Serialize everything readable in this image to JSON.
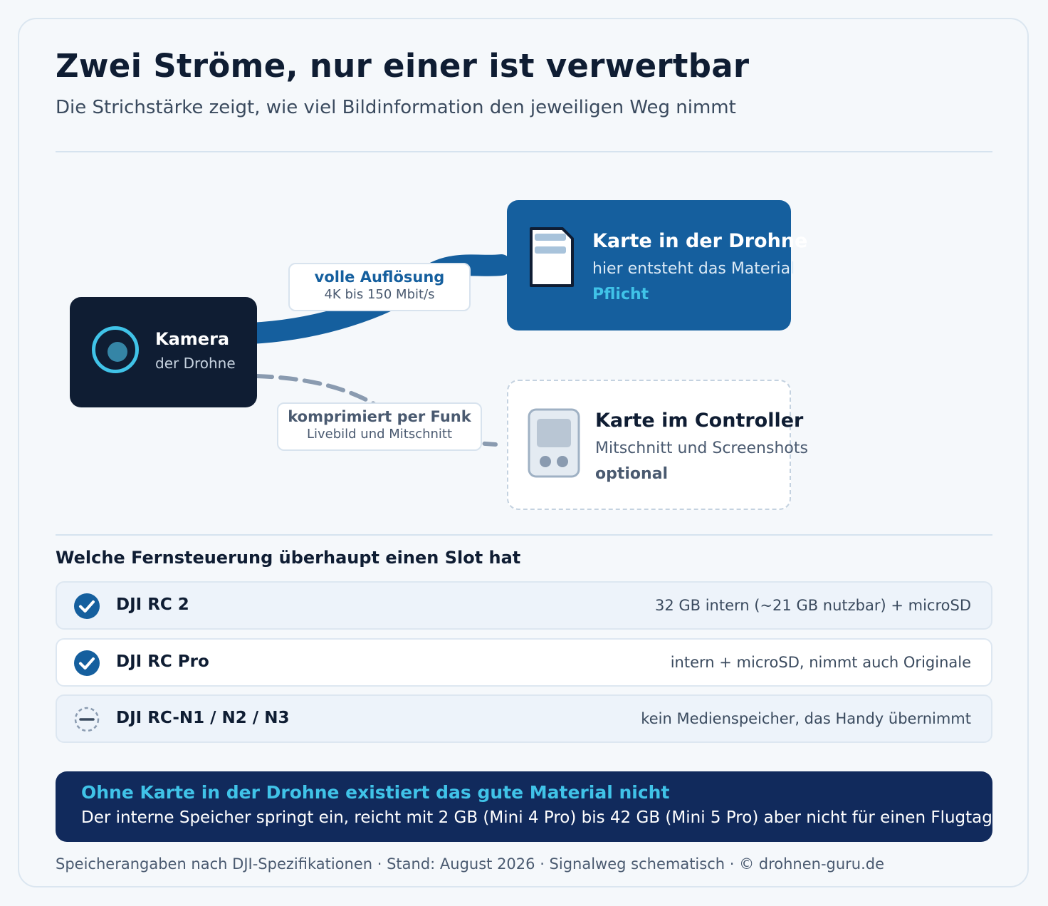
{
  "header": {
    "title": "Zwei Ströme, nur einer ist verwertbar",
    "subtitle": "Die Strichstärke zeigt, wie viel Bildinformation den jeweiligen Weg nimmt"
  },
  "diagram": {
    "camera": {
      "title": "Kamera",
      "subtitle": "der Drohne"
    },
    "drone_card": {
      "title": "Karte in der Drohne",
      "subtitle": "hier entsteht das Material",
      "tag": "Pflicht"
    },
    "controller_card": {
      "title": "Karte im Controller",
      "subtitle": "Mitschnitt und Screenshots",
      "tag": "optional"
    },
    "link_full": {
      "label": "volle Auflösung",
      "detail": "4K bis 150 Mbit/s"
    },
    "link_radio": {
      "label": "komprimiert per Funk",
      "detail": "Livebild und Mitschnitt"
    }
  },
  "controllers": {
    "title": "Welche Fernsteuerung überhaupt einen Slot hat",
    "rows": [
      {
        "name": "DJI RC 2",
        "detail": "32 GB intern (~21 GB nutzbar) + microSD",
        "status": "yes"
      },
      {
        "name": "DJI RC Pro",
        "detail": "intern + microSD, nimmt auch Originale",
        "status": "yes"
      },
      {
        "name": "DJI RC-N1 / N2 / N3",
        "detail": "kein Medienspeicher, das Handy übernimmt",
        "status": "no"
      }
    ]
  },
  "banner": {
    "title": "Ohne Karte in der Drohne existiert das gute Material nicht",
    "text": "Der interne Speicher springt ein, reicht mit 2 GB (Mini 4 Pro) bis 42 GB (Mini 5 Pro) aber nicht für einen Flugtag"
  },
  "footer": "Speicherangaben nach DJI-Spezifikationen · Stand: August 2026 · Signalweg schematisch · © drohnen-guru.de",
  "colors": {
    "navy": "#0f1d33",
    "blue": "#155f9e",
    "cyan": "#40c3e8",
    "banner": "#112a5c",
    "dashed_link": "#8a9bb0"
  },
  "icons": {
    "camera": "lens-icon",
    "drone_card": "sd-card-icon",
    "controller_card": "controller-icon",
    "row_yes": "check-circle-icon",
    "row_no": "minus-circle-icon"
  }
}
